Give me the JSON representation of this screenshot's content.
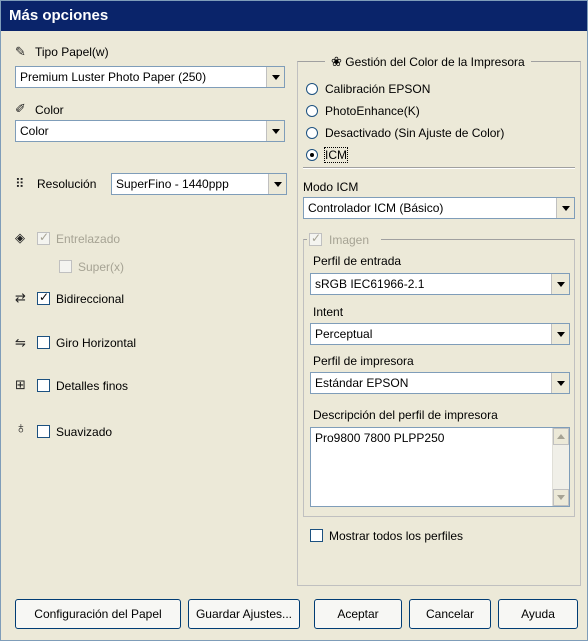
{
  "window": {
    "title": "Más opciones"
  },
  "left": {
    "paper_type_label": "Tipo Papel(w)",
    "paper_type_value": "Premium Luster Photo Paper (250)",
    "color_label": "Color",
    "color_value": "Color",
    "resolution_label": "Resolución",
    "resolution_value": "SuperFino - 1440ppp",
    "interlace_label": "Entrelazado",
    "interlace_checked": true,
    "super_label": "Super(x)",
    "super_checked": false,
    "bidirectional_label": "Bidireccional",
    "bidirectional_checked": true,
    "flip_label": "Giro Horizontal",
    "flip_checked": false,
    "fine_detail_label": "Detalles finos",
    "fine_detail_checked": false,
    "smoothing_label": "Suavizado",
    "smoothing_checked": false
  },
  "right": {
    "group_title": "Gestión del Color de la Impresora",
    "radio_epson": "Calibración EPSON",
    "radio_photoenhance": "PhotoEnhance(K)",
    "radio_off": "Desactivado (Sin Ajuste de Color)",
    "radio_icm": "ICM",
    "selected": "ICM",
    "icm_mode_label": "Modo ICM",
    "icm_mode_value": "Controlador ICM (Básico)",
    "image_label": "Imagen",
    "image_checked": true,
    "input_profile_label": "Perfil de entrada",
    "input_profile_value": "sRGB IEC61966-2.1",
    "intent_label": "Intent",
    "intent_value": "Perceptual",
    "printer_profile_label": "Perfil de impresora",
    "printer_profile_value": "Estándar EPSON",
    "printer_profile_desc_label": "Descripción del perfil de impresora",
    "printer_profile_desc_value": "Pro9800 7800 PLPP250",
    "show_all_label": "Mostrar todos los perfiles",
    "show_all_checked": false
  },
  "buttons": {
    "paper_config": "Configuración del Papel",
    "save": "Guardar Ajustes...",
    "accept": "Aceptar",
    "cancel": "Cancelar",
    "help": "Ayuda"
  },
  "colors": {
    "title_bar": "#0a246a",
    "dialog_bg": "#ece9d8",
    "disabled_text": "#a6a394"
  },
  "icons": [
    "paper-type-icon",
    "color-icon",
    "resolution-icon",
    "interlace-icon",
    "bidirectional-icon",
    "flip-horizontal-icon",
    "fine-detail-icon",
    "smoothing-icon",
    "color-management-icon"
  ]
}
